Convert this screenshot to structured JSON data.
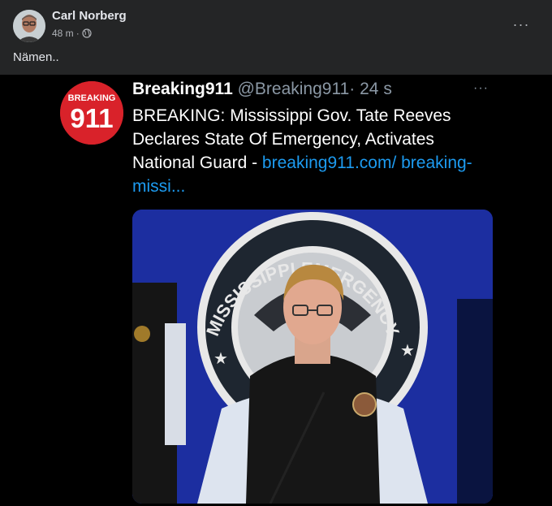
{
  "post": {
    "author": "Carl Norberg",
    "time": "48 m",
    "separator": "·",
    "privacy_icon": "globe-icon",
    "text": "Nämen..",
    "more": "···"
  },
  "tweet": {
    "avatar_text_top": "BREAKING",
    "avatar_text_big": "911",
    "name": "Breaking911",
    "handle": "@Breaking911",
    "separator": "·",
    "time": "24 s",
    "more": "···",
    "body": "BREAKING: Mississippi Gov. Tate Reeves Declares State Of Emergency, Activates National Guard - ",
    "link": "breaking911.com/ breaking-missi...",
    "photo": {
      "seal_text": "MISSISSIPPI EMERGENCY"
    }
  },
  "colors": {
    "background": "#242526",
    "media_background": "#000000",
    "link": "#1d9bf0",
    "avatar_red": "#d9222a",
    "photo_backdrop": "#1c2ea0"
  }
}
